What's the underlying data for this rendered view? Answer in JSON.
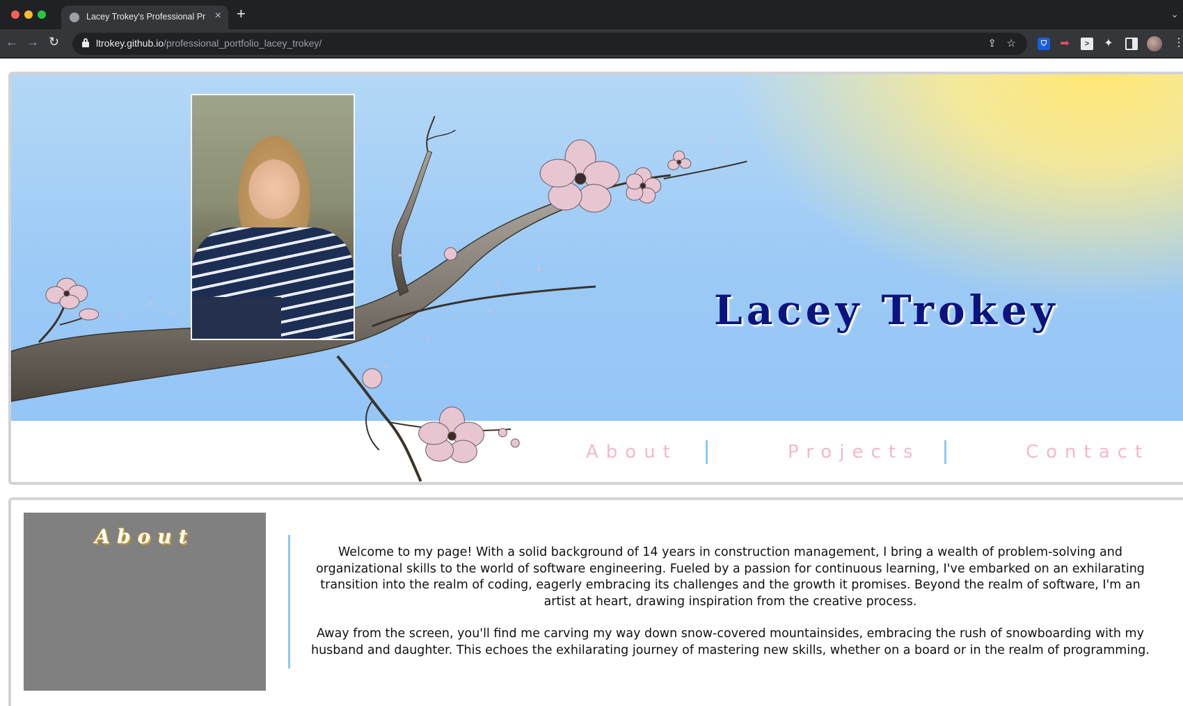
{
  "browser": {
    "tab_title": "Lacey Trokey's Professional Pr",
    "url_host": "ltrokey.github.io",
    "url_path": "/professional_portfolio_lacey_trokey/"
  },
  "header": {
    "title": "Lacey Trokey",
    "nav": {
      "about": "About",
      "projects": "Projects",
      "contact": "Contact"
    }
  },
  "about": {
    "heading": "About",
    "paragraph1": "Welcome to my page! With a solid background of 14 years in construction management, I bring a wealth of problem-solving and organizational skills to the world of software engineering. Fueled by a passion for continuous learning, I've embarked on an exhilarating transition into the realm of coding, eagerly embracing its challenges and the growth it promises. Beyond the realm of software, I'm an artist at heart, drawing inspiration from the creative process.",
    "paragraph2": "Away from the screen, you'll find me carving my way down snow-covered mountainsides, embracing the rush of snowboarding with my husband and daughter. This echoes the exhilarating journey of mastering new skills, whether on a board or in the realm of programming."
  },
  "icons": {
    "back": "arrow-left-icon",
    "forward": "arrow-right-icon",
    "reload": "reload-icon",
    "lock": "lock-icon",
    "share": "share-icon",
    "bookmark": "star-icon",
    "extensions": "puzzle-icon"
  },
  "colors": {
    "title": "#0b147e",
    "nav_link": "#f4b8c6",
    "nav_separator": "#8cc8f2",
    "about_box": "#808080"
  }
}
